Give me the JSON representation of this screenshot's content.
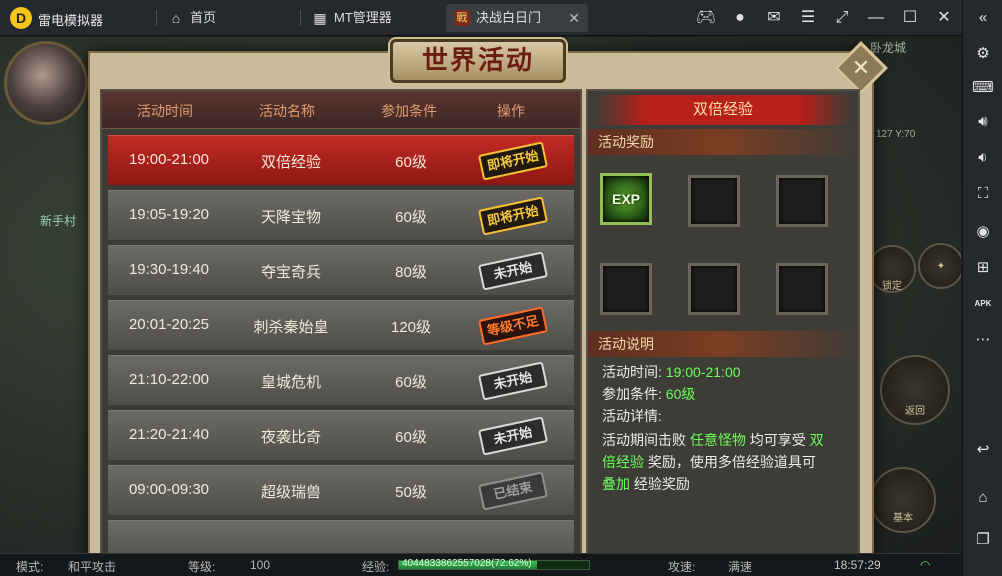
{
  "topbar": {
    "app_name": "雷电模拟器",
    "tabs": [
      {
        "label": "首页",
        "icon": "home-icon"
      },
      {
        "label": "MT管理器",
        "icon": "mt-manager-icon"
      },
      {
        "label": "决战白日门",
        "icon": "game-icon",
        "close": "✕"
      }
    ]
  },
  "game": {
    "map_name": "卧龙城",
    "coords": "127 Y:70",
    "player_tag": "新手村",
    "skill_lock": "锁定",
    "skill_back": "返回",
    "skill_basic": "基本"
  },
  "dialog": {
    "title": "世界活动",
    "close": "✕",
    "columns": [
      "活动时间",
      "活动名称",
      "参加条件",
      "操作"
    ],
    "rows": [
      {
        "time": "19:00-21:00",
        "name": "双倍经验",
        "level": "60级",
        "status": "即将开始",
        "kind": "soon"
      },
      {
        "time": "19:05-19:20",
        "name": "天降宝物",
        "level": "60级",
        "status": "即将开始",
        "kind": "soon"
      },
      {
        "time": "19:30-19:40",
        "name": "夺宝奇兵",
        "level": "80级",
        "status": "未开始",
        "kind": "notstart"
      },
      {
        "time": "20:01-20:25",
        "name": "刺杀秦始皇",
        "level": "120级",
        "status": "等级不足",
        "kind": "low"
      },
      {
        "time": "21:10-22:00",
        "name": "皇城危机",
        "level": "60级",
        "status": "未开始",
        "kind": "notstart"
      },
      {
        "time": "21:20-21:40",
        "name": "夜袭比奇",
        "level": "60级",
        "status": "未开始",
        "kind": "notstart"
      },
      {
        "time": "09:00-09:30",
        "name": "超级瑞兽",
        "level": "50级",
        "status": "已结束",
        "kind": "ended"
      }
    ],
    "detail": {
      "title": "双倍经验",
      "reward_header": "活动奖励",
      "reward_item": "EXP",
      "desc_header": "活动说明",
      "time_label": "活动时间:",
      "time_value": "19:00-21:00",
      "cond_label": "参加条件:",
      "cond_value": "60级",
      "detail_label": "活动详情:",
      "desc_parts": [
        "活动期间击败 ",
        "任意怪物",
        " 均可享受 ",
        "双倍经验",
        " 奖励，使用多倍经验道具可 ",
        "叠加",
        " 经验奖励"
      ]
    }
  },
  "bottombar": {
    "mode_label": "模式:",
    "mode_value": "和平攻击",
    "level_label": "等级:",
    "level_value": "100",
    "exp_label": "经验:",
    "exp_value": "4044833862557028(72.62%)",
    "exp_fraction": 0.7262,
    "speed_label": "攻速:",
    "speed_value": "满速",
    "time": "18:57:29"
  },
  "colors": {
    "accent_red": "#b71f19",
    "highlight_green": "#6cff5a",
    "stamp_yellow": "#f6c93c"
  }
}
